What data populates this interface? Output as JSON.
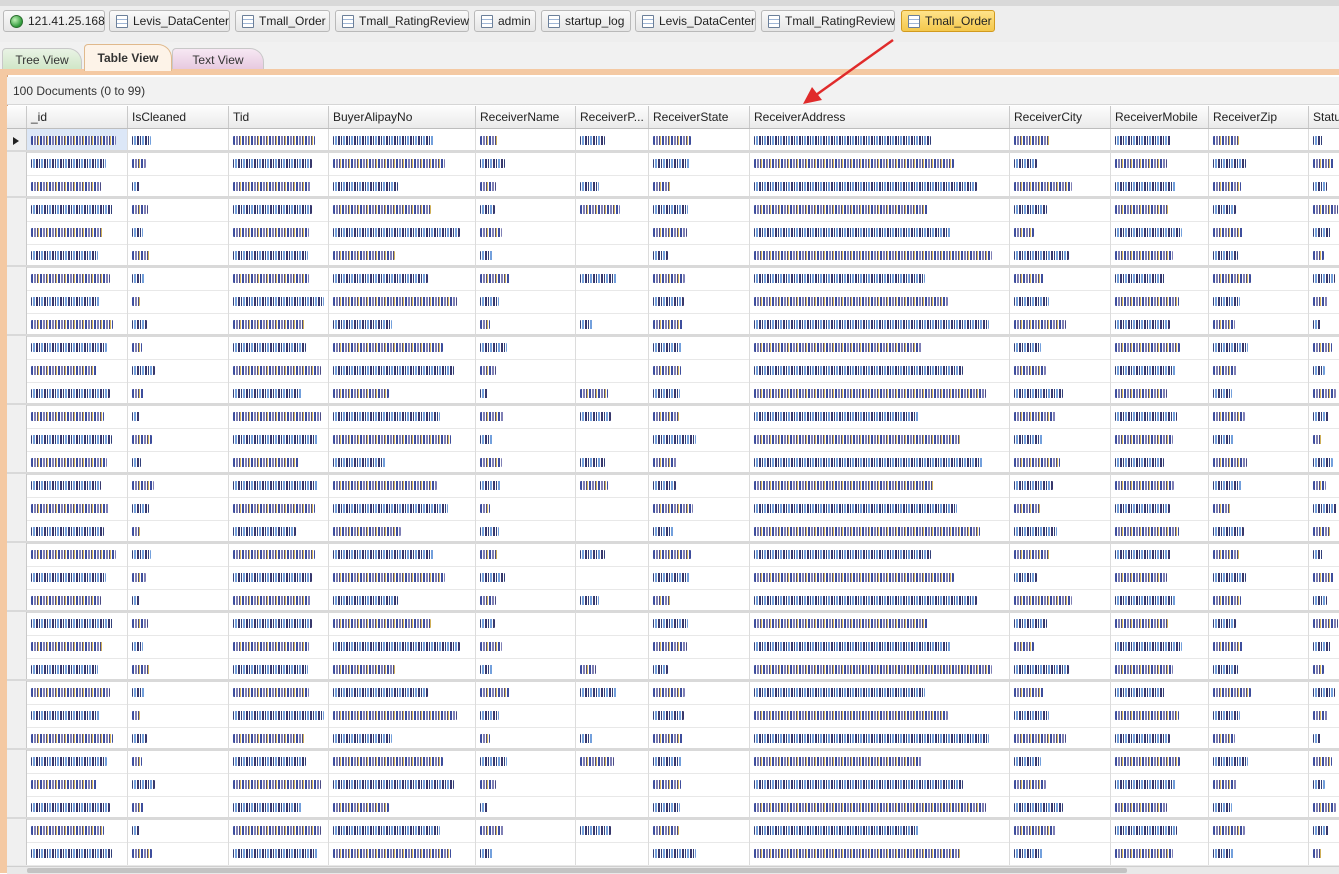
{
  "toolbar": {
    "tabs": [
      {
        "label": "121.41.25.168",
        "icon": "server-globe-icon"
      },
      {
        "label": "Levis_DataCenter",
        "icon": "database-icon"
      },
      {
        "label": "Tmall_Order",
        "icon": "collection-icon"
      },
      {
        "label": "Tmall_RatingReview",
        "icon": "collection-icon"
      },
      {
        "label": "admin",
        "icon": "database-icon"
      },
      {
        "label": "startup_log",
        "icon": "collection-icon"
      },
      {
        "label": "Levis_DataCenter",
        "icon": "database-icon"
      },
      {
        "label": "Tmall_RatingReview",
        "icon": "collection-icon"
      },
      {
        "label": "Tmall_Order",
        "icon": "collection-icon",
        "active": true
      }
    ]
  },
  "view_tabs": {
    "tree": "Tree View",
    "table": "Table View",
    "text": "Text View",
    "selected": "Table View"
  },
  "documents": {
    "count_label": "100 Documents (0 to 99)"
  },
  "columns": [
    "_id",
    "IsCleaned",
    "Tid",
    "BuyerAlipayNo",
    "ReceiverName",
    "ReceiverP...",
    "ReceiverState",
    "ReceiverAddress",
    "ReceiverCity",
    "ReceiverMobile",
    "ReceiverZip",
    "Statu"
  ],
  "colors": {
    "active_tab": "#f4c84c",
    "panel_accent": "#f4c9a3",
    "annotation_arrow": "#e02b2b",
    "row_selected": "#dce7f7"
  },
  "annotation": {
    "type": "arrow",
    "points_to": "ReceiverAddress column header"
  }
}
